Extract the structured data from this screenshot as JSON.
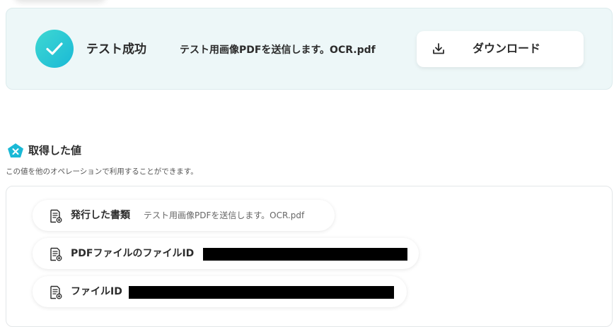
{
  "result": {
    "status_label": "テスト成功",
    "filename": "テスト用画像PDFを送信します。OCR.pdf",
    "download_label": "ダウンロード"
  },
  "values_section": {
    "title": "取得した値",
    "description": "この値を他のオペレーションで利用することができます。",
    "items": [
      {
        "label": "発行した書類",
        "value": "テスト用画像PDFを送信します。OCR.pdf"
      },
      {
        "label": "PDFファイルのファイルID",
        "value": ""
      },
      {
        "label": "ファイルID",
        "value": ""
      }
    ]
  },
  "icons": {
    "status": "check-circle-icon",
    "download": "download-icon",
    "section": "variable-icon",
    "item": "document-icon"
  },
  "colors": {
    "accent_teal": "#1ab9d6",
    "result_card_bg": "#edf7f8",
    "text": "#2c2c2c",
    "redaction": "#000000"
  }
}
